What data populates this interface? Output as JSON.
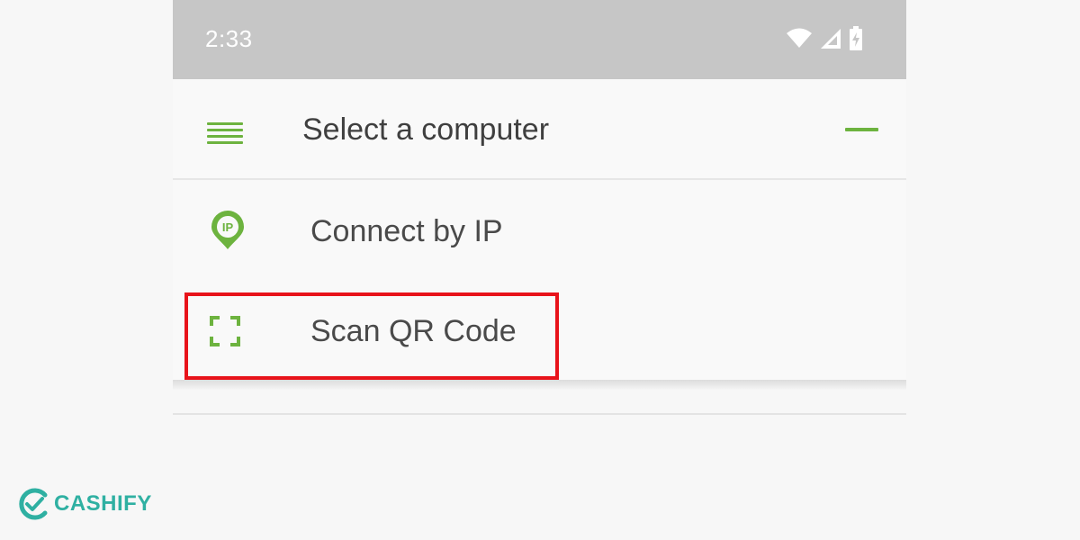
{
  "status_bar": {
    "time": "2:33",
    "icons": [
      "wifi-icon",
      "signal-icon",
      "battery-charging-icon"
    ]
  },
  "header": {
    "title": "Select a computer",
    "menu_icon": "menu-icon",
    "collapse_icon": "collapse-icon"
  },
  "menu": {
    "items": [
      {
        "label": "Connect by IP",
        "icon": "ip-location-pin-icon"
      },
      {
        "label": "Scan QR Code",
        "icon": "qr-scan-icon"
      }
    ]
  },
  "annotation": {
    "highlighted_item": "Scan QR Code",
    "color": "#e8131a"
  },
  "watermark": {
    "text": "CASHIFY",
    "color": "#2fb0a2"
  },
  "colors": {
    "accent": "#6db33f",
    "status_bar_bg": "#c6c6c6",
    "background": "#f7f7f7"
  }
}
